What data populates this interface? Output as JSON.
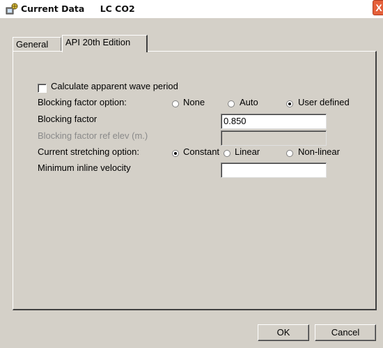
{
  "window": {
    "title": "Current Data",
    "subtitle": "LC CO2",
    "close_label": "X"
  },
  "tabs": [
    {
      "label": "General",
      "selected": false
    },
    {
      "label": "API 20th Edition",
      "selected": true
    }
  ],
  "form": {
    "calc_wave_label": "Calculate apparent wave period",
    "calc_wave_checked": false,
    "blocking_option_label": "Blocking factor option:",
    "blocking_options": [
      {
        "label": "None",
        "checked": false
      },
      {
        "label": "Auto",
        "checked": false
      },
      {
        "label": "User defined",
        "checked": true
      }
    ],
    "blocking_factor_label": "Blocking factor",
    "blocking_factor_value": "0.850",
    "blocking_ref_label": "Blocking factor ref elev  (m.)",
    "blocking_ref_value": "",
    "stretching_label": "Current stretching option:",
    "stretching_options": [
      {
        "label": "Constant",
        "checked": true
      },
      {
        "label": "Linear",
        "checked": false
      },
      {
        "label": "Non-linear",
        "checked": false
      }
    ],
    "min_velocity_label": "Minimum inline velocity",
    "min_velocity_value": ""
  },
  "buttons": {
    "ok": "OK",
    "cancel": "Cancel"
  }
}
